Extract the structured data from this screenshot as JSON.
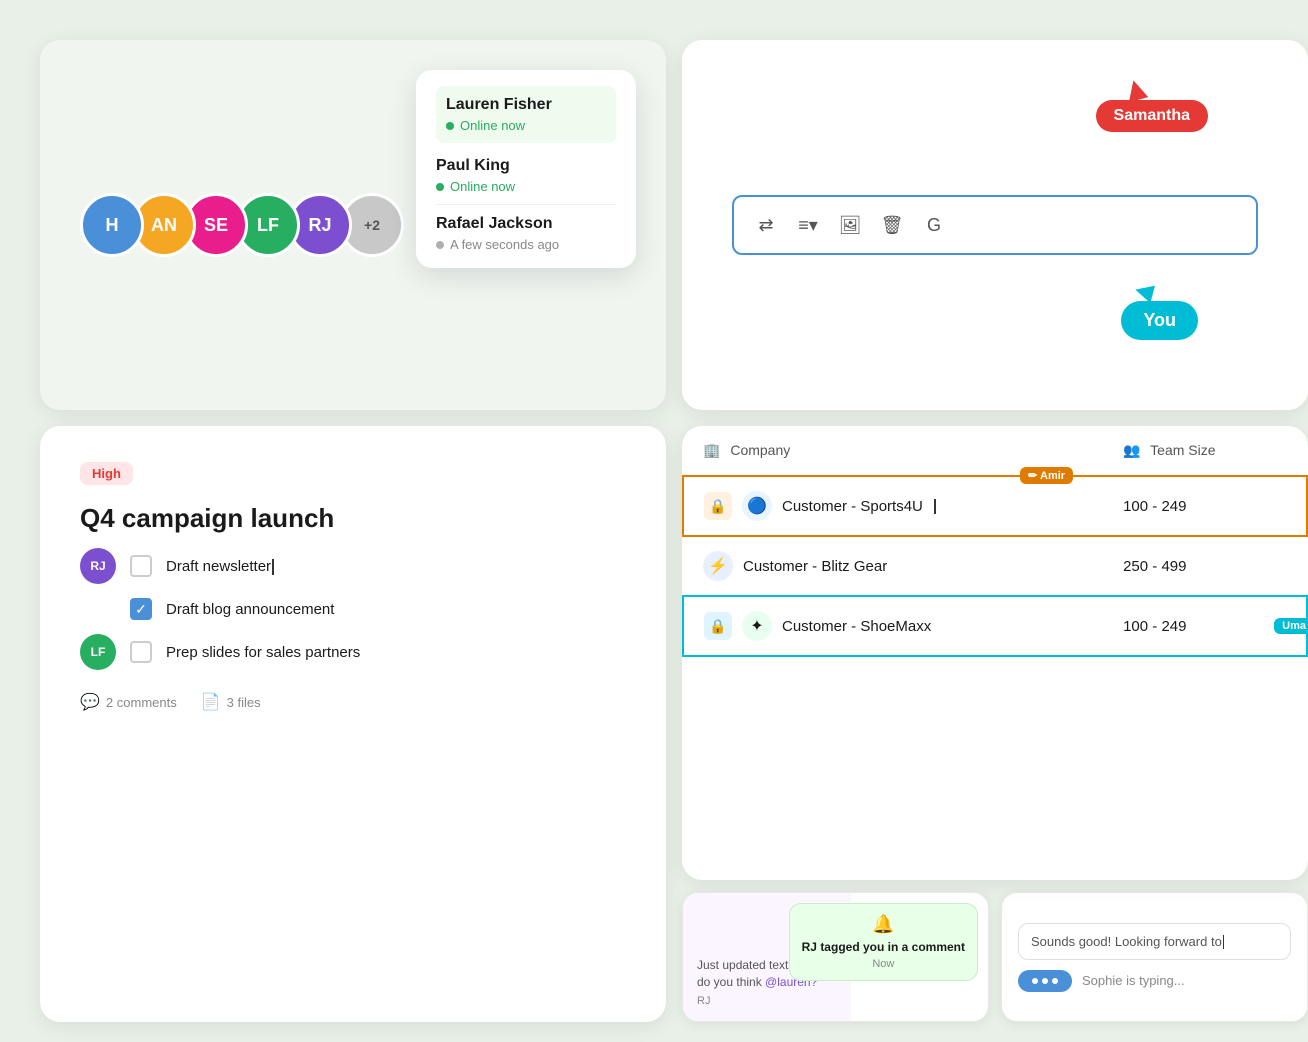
{
  "topLeft": {
    "avatars": [
      {
        "initials": "H",
        "color": "#4A90D9",
        "id": "h"
      },
      {
        "initials": "AN",
        "color": "#F5A623",
        "id": "an"
      },
      {
        "initials": "SE",
        "color": "#E91E8C",
        "id": "se"
      },
      {
        "initials": "LF",
        "color": "#27AE60",
        "id": "lf"
      },
      {
        "initials": "RJ",
        "color": "#7B4FD0",
        "id": "rj"
      },
      {
        "initials": "+2",
        "color": "#B0B0B0",
        "id": "plus"
      }
    ],
    "popup": {
      "users": [
        {
          "name": "Lauren Fisher",
          "status": "Online now",
          "online": true
        },
        {
          "name": "Paul King",
          "status": "Online now",
          "online": true
        },
        {
          "name": "Rafael Jackson",
          "status": "A few seconds ago",
          "online": false
        }
      ]
    }
  },
  "topRight": {
    "cursor1": {
      "label": "Samantha",
      "color": "#E53935"
    },
    "cursor2": {
      "label": "You",
      "color": "#00BCD4"
    },
    "toolbar": {
      "buttons": [
        "⇄",
        "≡▾",
        "🖼",
        "🗑",
        "G"
      ]
    }
  },
  "bottomLeft": {
    "priority": "High",
    "title": "Q4 campaign launch",
    "tasks": [
      {
        "text": "Draft newsletter",
        "checked": false,
        "avatar": "RJ",
        "avatarColor": "#7B4FD0",
        "editing": true
      },
      {
        "text": "Draft blog announcement",
        "checked": true,
        "avatar": null
      },
      {
        "text": "Prep slides for sales partners",
        "checked": false,
        "avatar": "LF",
        "avatarColor": "#27AE60"
      }
    ],
    "comments": "2 comments",
    "files": "3 files"
  },
  "bottomRight": {
    "columns": [
      "Company",
      "Team Size"
    ],
    "rows": [
      {
        "name": "Customer - Sports4U",
        "teamSize": "100 - 249",
        "logo": "🔵",
        "locked": true,
        "editing": true,
        "editor": "Amir"
      },
      {
        "name": "Customer - Blitz Gear",
        "teamSize": "250 - 499",
        "logo": "⚡",
        "locked": false,
        "editing": false
      },
      {
        "name": "Customer - ShoeMaxx",
        "teamSize": "100 - 249",
        "logo": "✦",
        "locked": true,
        "editing": false,
        "editor2": "Uma"
      }
    ]
  },
  "bottomMini": {
    "left": {
      "comment": "Just updated text, what do you think @lauren?",
      "author": "RJ",
      "notification": {
        "text": "RJ tagged you in a comment",
        "time": "Now"
      }
    },
    "right": {
      "inputText": "Sounds good! Looking forward to",
      "typingUser": "Sophie is typing..."
    }
  }
}
